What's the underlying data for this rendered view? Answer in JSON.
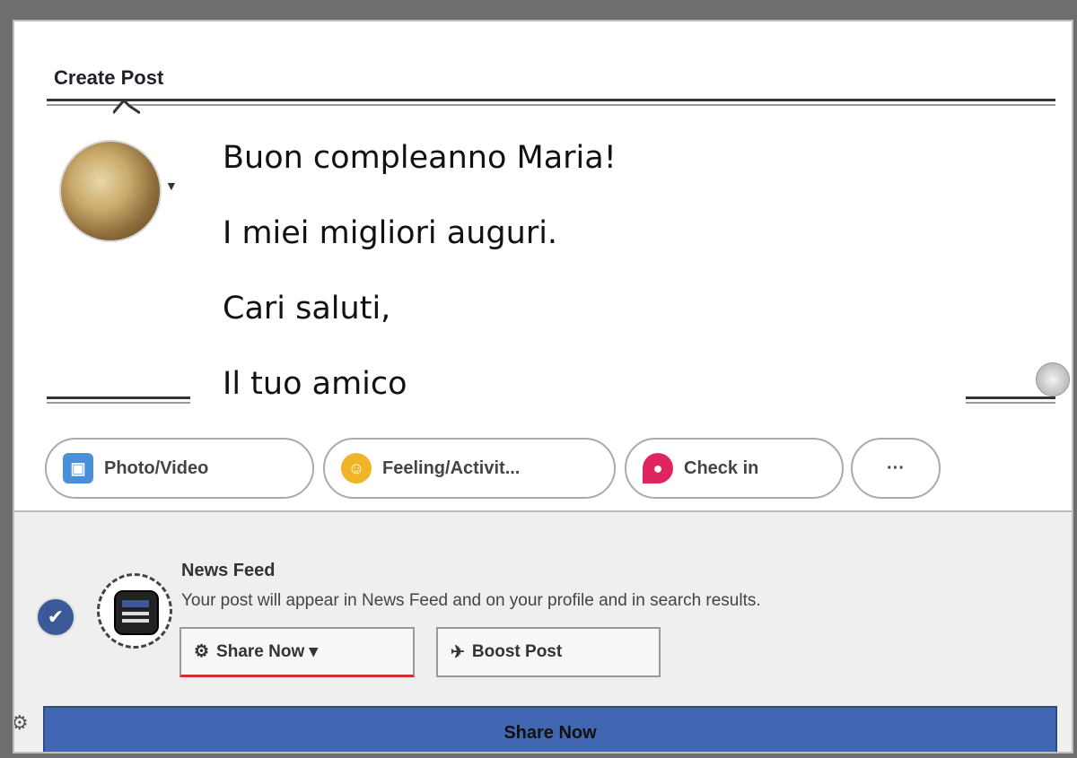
{
  "dialog": {
    "title": "Create Post"
  },
  "composer": {
    "lines": [
      "Buon compleanno Maria!",
      "I miei migliori auguri.",
      "Cari saluti,",
      "Il tuo amico"
    ]
  },
  "attachments": [
    {
      "label": "Photo/Video",
      "icon": "photo-icon",
      "color": "#4a90d9"
    },
    {
      "label": "Feeling/Activit...",
      "icon": "feeling-icon",
      "color": "#f0b429"
    },
    {
      "label": "Check in",
      "icon": "location-pin-icon",
      "color": "#e0245e"
    },
    {
      "label": "···",
      "icon": "more-icon",
      "color": "#999999"
    }
  ],
  "news_feed": {
    "title": "News Feed",
    "description": "Your post will appear in News Feed and on your profile and in search results.",
    "share_menu_label": "Share Now ▾",
    "boost_label": "Boost Post"
  },
  "share_button_label": "Share Now",
  "colors": {
    "brand": "#4267b2",
    "accent_underline": "#d32f2f"
  }
}
